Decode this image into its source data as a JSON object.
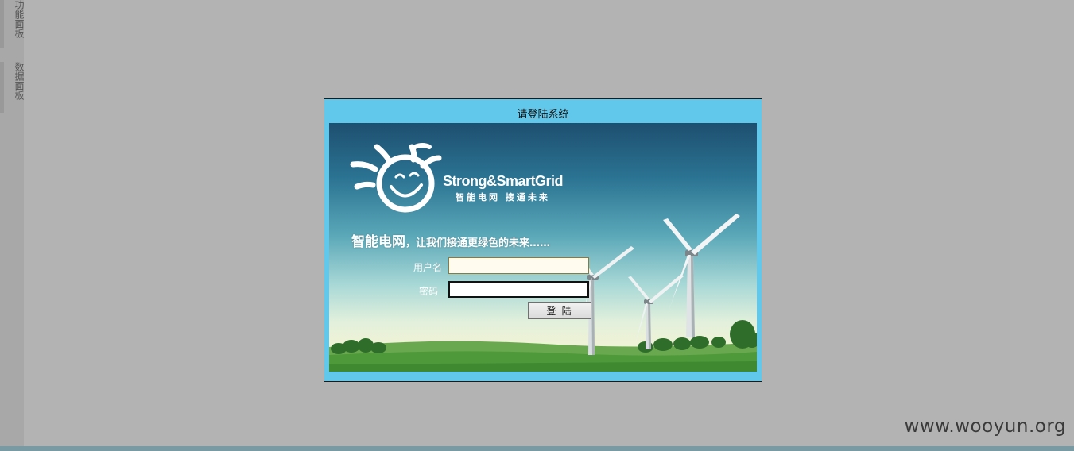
{
  "sidebar": {
    "tabs": [
      {
        "label": "功能面板"
      },
      {
        "label": "数据面板"
      }
    ]
  },
  "dialog": {
    "title": "请登陆系统",
    "brand_name": "Strong&SmartGrid",
    "brand_tagline": "智能电网 接通未来",
    "slogan_main": "智能电网",
    "slogan_rest": "，让我们接通更绿色的未来……",
    "username_label": "用户名",
    "username_value": "",
    "password_label": "密码",
    "password_value": "",
    "login_label": "登  陆"
  },
  "watermark": "www.wooyun.org",
  "colors": {
    "background": "#b3b3b3",
    "dialog_frame": "#62c8eb",
    "sky_top": "#1e4f70",
    "grass": "#4e9a3a"
  }
}
